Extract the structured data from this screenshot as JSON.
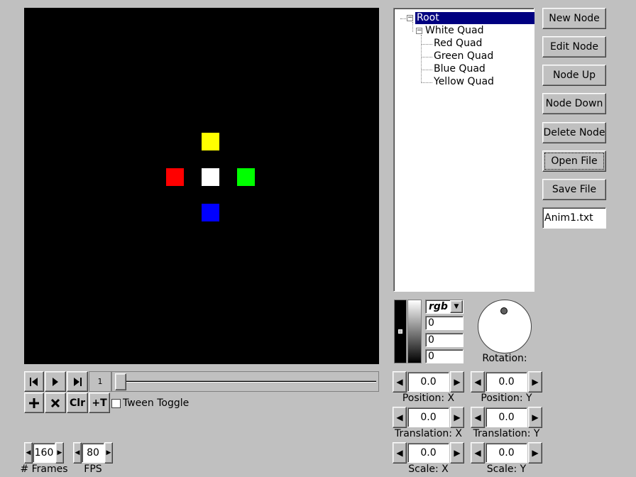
{
  "viewport": {
    "quads": [
      {
        "name": "yellow-quad",
        "color": "#ffff00"
      },
      {
        "name": "red-quad",
        "color": "#ff0000"
      },
      {
        "name": "white-quad",
        "color": "#ffffff"
      },
      {
        "name": "green-quad",
        "color": "#00ff00"
      },
      {
        "name": "blue-quad",
        "color": "#0000ff"
      }
    ]
  },
  "tree": {
    "root": "Root",
    "white": "White Quad",
    "children": [
      "Red Quad",
      "Green Quad",
      "Blue Quad",
      "Yellow Quad"
    ],
    "expander_minus": "−"
  },
  "buttons": {
    "new_node": "New Node",
    "edit_node": "Edit Node",
    "node_up": "Node Up",
    "node_down": "Node Down",
    "delete_node": "Delete Node",
    "open_file": "Open File",
    "save_file": "Save File"
  },
  "filename": "Anim1.txt",
  "color_panel": {
    "mode": "rgb",
    "r": "0",
    "g": "0",
    "b": "0",
    "rotation_label": "Rotation:"
  },
  "transform": {
    "position_x": {
      "value": "0.0",
      "label": "Position: X"
    },
    "position_y": {
      "value": "0.0",
      "label": "Position: Y"
    },
    "translation_x": {
      "value": "0.0",
      "label": "Translation: X"
    },
    "translation_y": {
      "value": "0.0",
      "label": "Translation: Y"
    },
    "scale_x": {
      "value": "0.0",
      "label": "Scale: X"
    },
    "scale_y": {
      "value": "0.0",
      "label": "Scale: Y"
    }
  },
  "timeline": {
    "frame": "1",
    "clear_label": "Clr",
    "add_tween_label": "+T",
    "tween_toggle_label": "Tween Toggle"
  },
  "frames": {
    "value": "160",
    "label": "# Frames"
  },
  "fps": {
    "value": "80",
    "label": "FPS"
  }
}
